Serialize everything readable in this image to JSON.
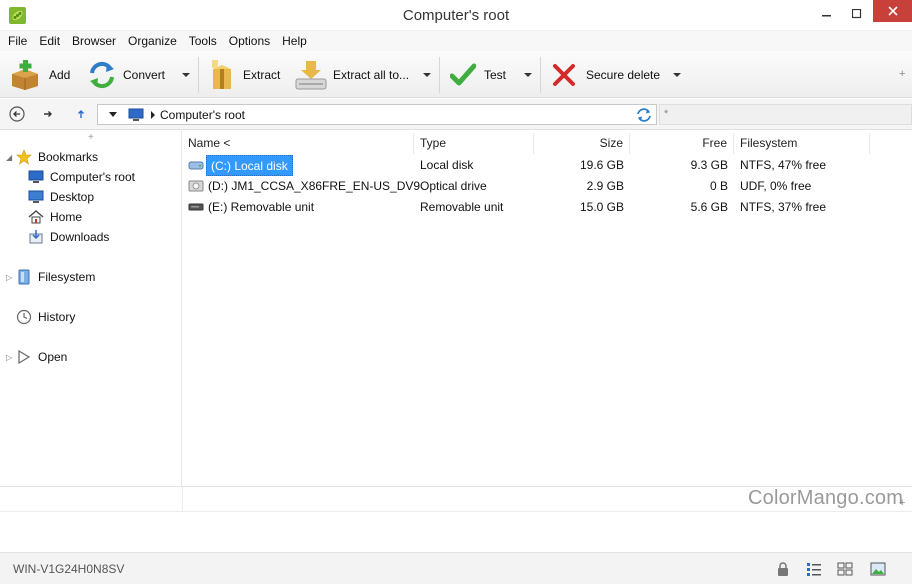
{
  "window": {
    "title": "Computer's root"
  },
  "menu": {
    "items": [
      "File",
      "Edit",
      "Browser",
      "Organize",
      "Tools",
      "Options",
      "Help"
    ]
  },
  "toolbar": {
    "add": "Add",
    "convert": "Convert",
    "extract": "Extract",
    "extract_all": "Extract all to...",
    "test": "Test",
    "secure_delete": "Secure delete",
    "more": "+"
  },
  "address": {
    "path": "Computer's root",
    "filter_placeholder": "*"
  },
  "sidebar": {
    "bookmarks": "Bookmarks",
    "bookmark_items": [
      "Computer's root",
      "Desktop",
      "Home",
      "Downloads"
    ],
    "filesystem": "Filesystem",
    "history": "History",
    "open": "Open"
  },
  "filelist": {
    "columns": [
      "Name <",
      "Type",
      "Size",
      "Free",
      "Filesystem"
    ],
    "rows": [
      {
        "name": "(C:) Local disk",
        "type": "Local disk",
        "size": "19.6 GB",
        "free": "9.3 GB",
        "fs": "NTFS, 47% free",
        "icon": "hard-drive-icon"
      },
      {
        "name": "(D:) JM1_CCSA_X86FRE_EN-US_DV9",
        "type": "Optical drive",
        "size": "2.9 GB",
        "free": "0 B",
        "fs": "UDF, 0% free",
        "icon": "optical-drive-icon"
      },
      {
        "name": "(E:) Removable unit",
        "type": "Removable unit",
        "size": "15.0 GB",
        "free": "5.6 GB",
        "fs": "NTFS, 37% free",
        "icon": "removable-drive-icon"
      }
    ]
  },
  "watermark": "ColorMango.com",
  "status": {
    "machine": "WIN-V1G24H0N8SV"
  },
  "colors": {
    "selection": "#3399ff",
    "close": "#c7413a",
    "toolbar": "#f2f2f2"
  }
}
